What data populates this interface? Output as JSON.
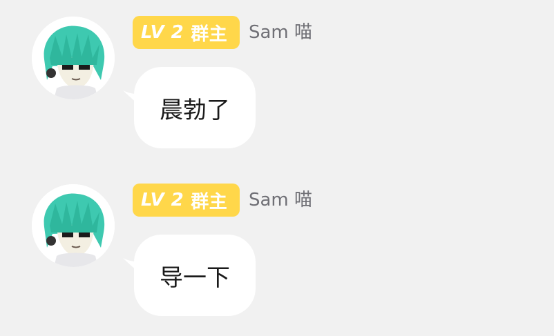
{
  "colors": {
    "background": "#f1f1f1",
    "badge": "#ffd74a",
    "badge_text": "#ffffff",
    "username": "#6f6f75",
    "bubble": "#ffffff"
  },
  "messages": [
    {
      "badge_level": "LV 2",
      "badge_role": "群主",
      "username": "Sam 喵",
      "avatar_icon": "anime-avatar-icon",
      "text": "晨勃了"
    },
    {
      "badge_level": "LV 2",
      "badge_role": "群主",
      "username": "Sam 喵",
      "avatar_icon": "anime-avatar-icon",
      "text": "导一下"
    }
  ]
}
